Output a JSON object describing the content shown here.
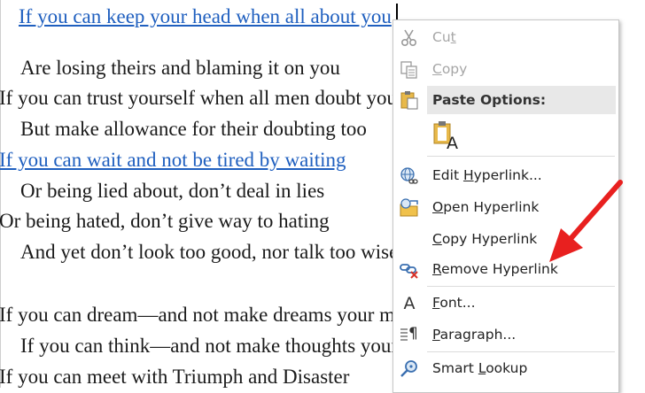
{
  "document": {
    "lines": [
      {
        "text": "If you can keep your head when all about you",
        "link": true
      },
      {
        "text": "Are losing theirs and blaming it on you",
        "link": false
      },
      {
        "text": "If you can trust yourself when all men doubt you",
        "link": false
      },
      {
        "text": "But make allowance for their doubting too",
        "link": false
      },
      {
        "text": "If you can wait and not be tired by waiting",
        "link": true
      },
      {
        "text": "Or being lied about, don’t deal in lies",
        "link": false
      },
      {
        "text": "Or being hated, don’t give way to hating",
        "link": false
      },
      {
        "text": "And yet don’t look too good, nor talk too wise",
        "link": false
      },
      {
        "text": "If you can dream—and not make dreams your master;",
        "link": false
      },
      {
        "text": "If you can think—and not make thoughts your aim;",
        "link": false
      },
      {
        "text": "If you can meet with Triumph and Disaster",
        "link": false
      }
    ]
  },
  "context_menu": {
    "cut": {
      "label": "Cut",
      "icon": "scissors-icon",
      "enabled": false
    },
    "copy": {
      "label": "Copy",
      "icon": "copy-icon",
      "enabled": false
    },
    "paste_options": {
      "label": "Paste Options:",
      "icon": "clipboard-icon"
    },
    "paste_keep_text": {
      "icon": "paste-keep-text-only-icon",
      "letter": "A"
    },
    "edit_hyperlink": {
      "label": "Edit Hyperlink...",
      "icon": "globe-link-icon"
    },
    "open_hyperlink": {
      "label": "Open Hyperlink",
      "icon": "folder-link-icon"
    },
    "copy_hyperlink": {
      "label": "Copy Hyperlink"
    },
    "remove_hyperlink": {
      "label": "Remove Hyperlink",
      "icon": "unlink-icon"
    },
    "font": {
      "label": "Font...",
      "icon": "font-icon",
      "glyph": "A"
    },
    "paragraph": {
      "label": "Paragraph...",
      "icon": "paragraph-icon",
      "glyph": "¶"
    },
    "smart_lookup": {
      "label": "Smart Lookup",
      "icon": "search-icon"
    }
  },
  "annotation": {
    "color": "#e8201f"
  }
}
